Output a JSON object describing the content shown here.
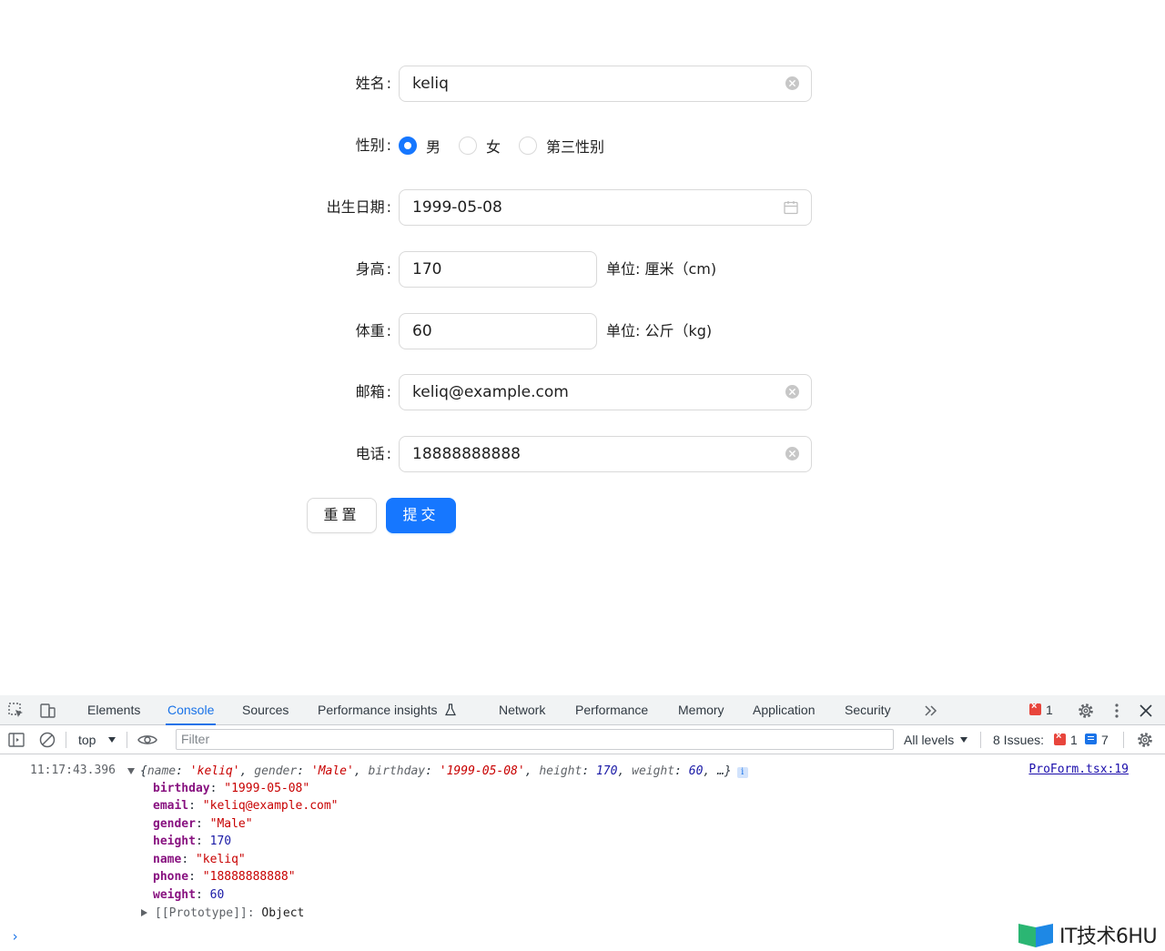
{
  "form": {
    "name": {
      "label": "姓名",
      "value": "keliq"
    },
    "gender": {
      "label": "性别",
      "options": [
        "男",
        "女",
        "第三性别"
      ],
      "selected": "男"
    },
    "birthday": {
      "label": "出生日期",
      "value": "1999-05-08"
    },
    "height": {
      "label": "身高",
      "value": "170",
      "unit_label": "单位",
      "unit": "厘米（cm)"
    },
    "weight": {
      "label": "体重",
      "value": "60",
      "unit_label": "单位",
      "unit": "公斤（kg)"
    },
    "email": {
      "label": "邮箱",
      "value": "keliq@example.com"
    },
    "phone": {
      "label": "电话",
      "value": "18888888888"
    },
    "buttons": {
      "reset": "重置",
      "submit": "提交"
    },
    "accent_color": "#1677ff"
  },
  "devtools": {
    "tabs": [
      "Elements",
      "Console",
      "Sources",
      "Performance insights",
      "Network",
      "Performance",
      "Memory",
      "Application",
      "Security"
    ],
    "active_tab": "Console",
    "more_tabs_icon": "chevron-double-right-icon",
    "error_count": "1",
    "toolbar": {
      "context": "top",
      "filter_placeholder": "Filter",
      "levels": "All levels",
      "issues_label": "8 Issues:",
      "issues_errors": "1",
      "issues_messages": "7"
    },
    "console": {
      "timestamp": "11:17:43.396",
      "source": "ProForm.tsx:19",
      "summary": {
        "name_key": "name",
        "name_val": "'keliq'",
        "gender_key": "gender",
        "gender_val": "'Male'",
        "birthday_key": "birthday",
        "birthday_val": "'1999-05-08'",
        "height_key": "height",
        "height_val": "170",
        "weight_key": "weight",
        "weight_val": "60",
        "ellipsis": "…}"
      },
      "properties": [
        {
          "key": "birthday",
          "value": "\"1999-05-08\"",
          "type": "string"
        },
        {
          "key": "email",
          "value": "\"keliq@example.com\"",
          "type": "string"
        },
        {
          "key": "gender",
          "value": "\"Male\"",
          "type": "string"
        },
        {
          "key": "height",
          "value": "170",
          "type": "number"
        },
        {
          "key": "name",
          "value": "\"keliq\"",
          "type": "string"
        },
        {
          "key": "phone",
          "value": "\"18888888888\"",
          "type": "string"
        },
        {
          "key": "weight",
          "value": "60",
          "type": "number"
        }
      ],
      "prototype_key": "[[Prototype]]",
      "prototype_val": "Object"
    }
  },
  "watermark": "IT技术6HU"
}
